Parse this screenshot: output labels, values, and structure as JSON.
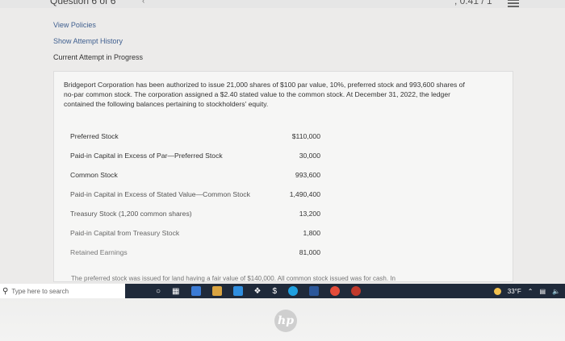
{
  "header": {
    "question_indicator": "Question 6 of 6",
    "score": ", 0.41 / 1"
  },
  "links": {
    "view_policies": "View Policies",
    "show_attempt_history": "Show Attempt History",
    "current_attempt": "Current Attempt in Progress"
  },
  "problem": {
    "prompt_line1": "Bridgeport Corporation has been authorized to issue 21,000 shares of $100 par value, 10%, preferred stock and 993,600 shares of",
    "prompt_line2": "no-par common stock. The corporation assigned a $2.40 stated value to the common stock. At December 31, 2022, the ledger",
    "prompt_line3": "contained the following balances pertaining to stockholders' equity.",
    "balances": [
      {
        "label": "Preferred Stock",
        "amount": "$110,000"
      },
      {
        "label": "Paid-in Capital in Excess of Par—Preferred Stock",
        "amount": "30,000"
      },
      {
        "label": "Common Stock",
        "amount": "993,600"
      },
      {
        "label": "Paid-in Capital in Excess of Stated Value—Common Stock",
        "amount": "1,490,400"
      },
      {
        "label": "Treasury Stock (1,200 common shares)",
        "amount": "13,200"
      },
      {
        "label": "Paid-in Capital from Treasury Stock",
        "amount": "1,800"
      },
      {
        "label": "Retained Earnings",
        "amount": "81,000"
      }
    ],
    "continued_text": "The preferred stock was issued for land having a fair value of $140,000. All common stock issued was for cash. In"
  },
  "taskbar": {
    "search_placeholder": "Type here to search",
    "temperature": "33°F"
  },
  "brand": "hp",
  "colors": {
    "link": "#3f5f8f",
    "taskbar": "#1f2a3a",
    "panel": "#f6f6f5"
  }
}
